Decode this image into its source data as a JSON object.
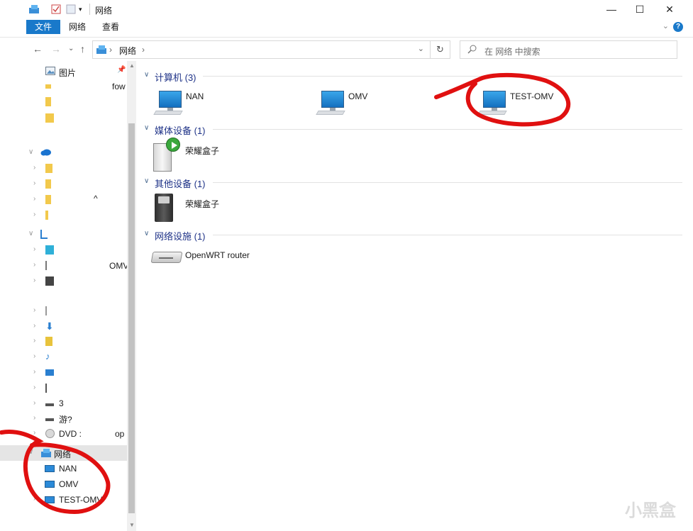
{
  "window": {
    "title": "网络",
    "buttons": {
      "minimize": "—",
      "maximize": "☐",
      "close": "✕"
    }
  },
  "ribbon": {
    "tabs": [
      "文件",
      "网络",
      "查看"
    ],
    "collapse": "⌄",
    "help": "?"
  },
  "address_bar": {
    "back": "←",
    "forward": "→",
    "recent": "⌄",
    "up": "↑",
    "path_sep": "›",
    "path": "网络",
    "path_end": "›",
    "dropdown": "⌄",
    "refresh": "↻",
    "search_placeholder": "在 网络 中搜索"
  },
  "nav": {
    "pinned_pictures": "图片",
    "partial_texts": [
      "fow",
      "^",
      "OMV",
      "DVD :",
      "op",
      "游?",
      "3"
    ],
    "network": "网络",
    "network_children": [
      "NAN",
      "OMV",
      "TEST-OMV"
    ]
  },
  "groups": [
    {
      "title": "计算机 (3)",
      "items": [
        "NAN",
        "OMV",
        "TEST-OMV"
      ]
    },
    {
      "title": "媒体设备 (1)",
      "items": [
        "荣耀盒子"
      ]
    },
    {
      "title": "其他设备 (1)",
      "items": [
        "荣耀盒子"
      ]
    },
    {
      "title": "网络设施 (1)",
      "items": [
        "OpenWRT router"
      ]
    }
  ],
  "watermark": "小黑盒",
  "colors": {
    "accent": "#1979ca",
    "group_title": "#1e3287",
    "annotation": "#e01010"
  }
}
